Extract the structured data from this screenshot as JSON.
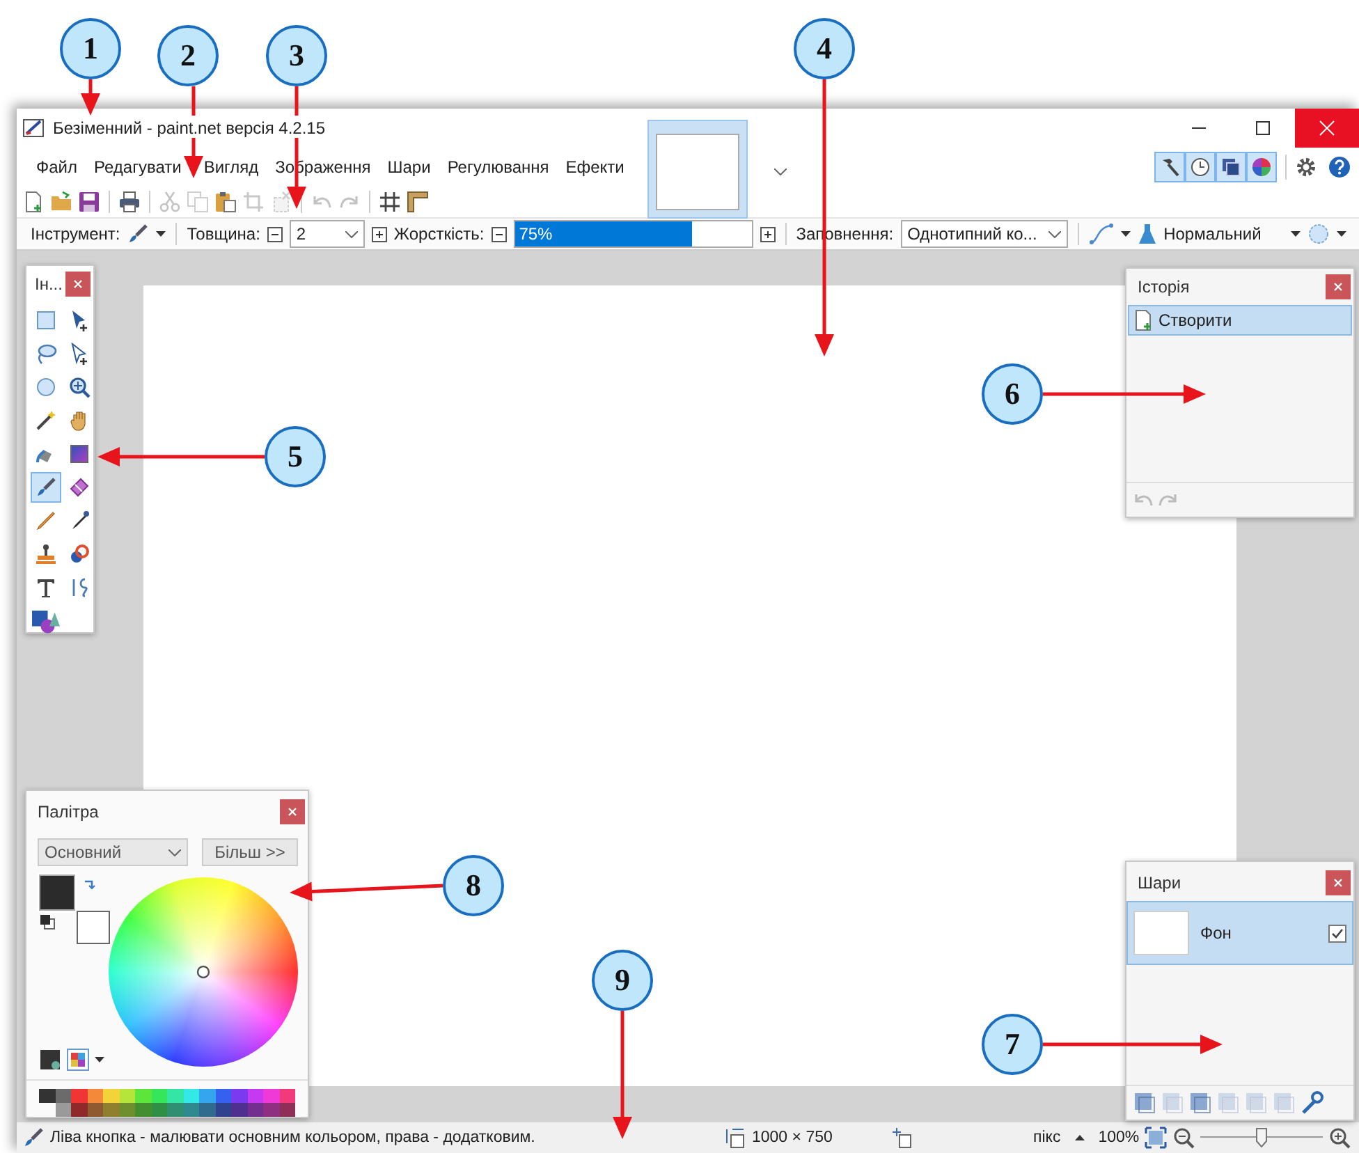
{
  "window": {
    "title": "Безіменний - paint.net версія 4.2.15"
  },
  "menu": [
    "Файл",
    "Редагувати",
    "Вигляд",
    "Зображення",
    "Шари",
    "Регулювання",
    "Ефекти"
  ],
  "image_tabs": [
    {
      "selected": true
    }
  ],
  "panel_toggles": [
    {
      "kind": "tools",
      "selected": true
    },
    {
      "kind": "history",
      "selected": true
    },
    {
      "kind": "layers",
      "selected": true
    },
    {
      "kind": "colors",
      "selected": true
    }
  ],
  "toolbar": [
    {
      "kind": "new",
      "disabled": false
    },
    {
      "kind": "open",
      "disabled": false
    },
    {
      "kind": "save",
      "disabled": false
    },
    {
      "kind": "sep"
    },
    {
      "kind": "print",
      "disabled": false
    },
    {
      "kind": "sep"
    },
    {
      "kind": "cut",
      "disabled": true
    },
    {
      "kind": "copy",
      "disabled": true
    },
    {
      "kind": "paste",
      "disabled": false
    },
    {
      "kind": "crop",
      "disabled": true
    },
    {
      "kind": "deselect",
      "disabled": true
    },
    {
      "kind": "sep"
    },
    {
      "kind": "undo",
      "disabled": true
    },
    {
      "kind": "redo",
      "disabled": true
    },
    {
      "kind": "sep"
    },
    {
      "kind": "grid",
      "disabled": false
    },
    {
      "kind": "ruler",
      "disabled": false
    }
  ],
  "options": {
    "tool_label": "Інструмент:",
    "width_label": "Товщина:",
    "width_value": "2",
    "hardness_label": "Жорсткість:",
    "hardness_reading": "75%",
    "hardness": {
      "level": 0.75
    },
    "fill_label": "Заповнення:",
    "fill_value": "Однотипний ко...",
    "blend_mode": "Нормальний"
  },
  "tools_panel": {
    "title": "Ін...",
    "tools": [
      {
        "kind": "rect-select",
        "selected": false
      },
      {
        "kind": "move-pixels",
        "selected": false
      },
      {
        "kind": "lasso",
        "selected": false
      },
      {
        "kind": "move-selection",
        "selected": false
      },
      {
        "kind": "ellipse-select",
        "selected": false
      },
      {
        "kind": "zoom",
        "selected": false
      },
      {
        "kind": "magic-wand",
        "selected": false
      },
      {
        "kind": "pan",
        "selected": false
      },
      {
        "kind": "bucket",
        "selected": false
      },
      {
        "kind": "gradient",
        "selected": false
      },
      {
        "kind": "brush",
        "selected": true
      },
      {
        "kind": "eraser",
        "selected": false
      },
      {
        "kind": "pencil",
        "selected": false
      },
      {
        "kind": "picker",
        "selected": false
      },
      {
        "kind": "stamp",
        "selected": false
      },
      {
        "kind": "recolor",
        "selected": false
      },
      {
        "kind": "text",
        "selected": false
      },
      {
        "kind": "curve",
        "selected": false
      },
      {
        "kind": "shapes",
        "selected": false
      }
    ]
  },
  "history_panel": {
    "title": "Історія",
    "items": [
      {
        "label": "Створити",
        "selected": true
      }
    ]
  },
  "palette_panel": {
    "title": "Палітра",
    "mode": "Основний",
    "more_button": "Більш >>",
    "color_swatches": [
      {
        "kind": "secondary",
        "color": "#ffffff"
      },
      {
        "kind": "primary",
        "color": "#2b2b2b"
      }
    ],
    "swatch_rows": [
      {
        "swatches": [
          {
            "color": "#333333"
          },
          {
            "color": "#6b6b6b"
          },
          {
            "color": "#f03535"
          },
          {
            "color": "#f5893a"
          },
          {
            "color": "#f2d33a"
          },
          {
            "color": "#b5e53a"
          },
          {
            "color": "#5ce53a"
          },
          {
            "color": "#35e55a"
          },
          {
            "color": "#35e5a5"
          },
          {
            "color": "#35e8e8"
          },
          {
            "color": "#35a5f0"
          },
          {
            "color": "#3560f0"
          },
          {
            "color": "#7a3af0"
          },
          {
            "color": "#c53af0"
          },
          {
            "color": "#f03ad8"
          },
          {
            "color": "#f03a7a"
          }
        ]
      },
      {
        "swatches": [
          {
            "color": "#9a9a9a"
          },
          {
            "color": "#8f2a2a"
          },
          {
            "color": "#8f5a2f"
          },
          {
            "color": "#8f7f2f"
          },
          {
            "color": "#6f8f2f"
          },
          {
            "color": "#438f2f"
          },
          {
            "color": "#2f8f45"
          },
          {
            "color": "#2f8f70"
          },
          {
            "color": "#2f8a8f"
          },
          {
            "color": "#2f6a8f"
          },
          {
            "color": "#2f428f"
          },
          {
            "color": "#4f2f8f"
          },
          {
            "color": "#722f8f"
          },
          {
            "color": "#8f2f82"
          },
          {
            "color": "#8f2f55"
          }
        ]
      }
    ]
  },
  "layers_panel": {
    "title": "Шари",
    "layers": [
      {
        "name": "Фон",
        "selected": true,
        "visible": true
      }
    ]
  },
  "status_bar": {
    "hint": "Ліва кнопка - малювати основним кольором, права - додатковим.",
    "size": "1000 × 750",
    "unit": "пікс",
    "zoom": "100%",
    "zoom_slider": {
      "level": 0.5
    }
  },
  "callouts": [
    {
      "number": "1"
    },
    {
      "number": "2"
    },
    {
      "number": "3"
    },
    {
      "number": "4"
    },
    {
      "number": "5"
    },
    {
      "number": "6"
    },
    {
      "number": "7"
    },
    {
      "number": "8"
    },
    {
      "number": "9"
    }
  ]
}
